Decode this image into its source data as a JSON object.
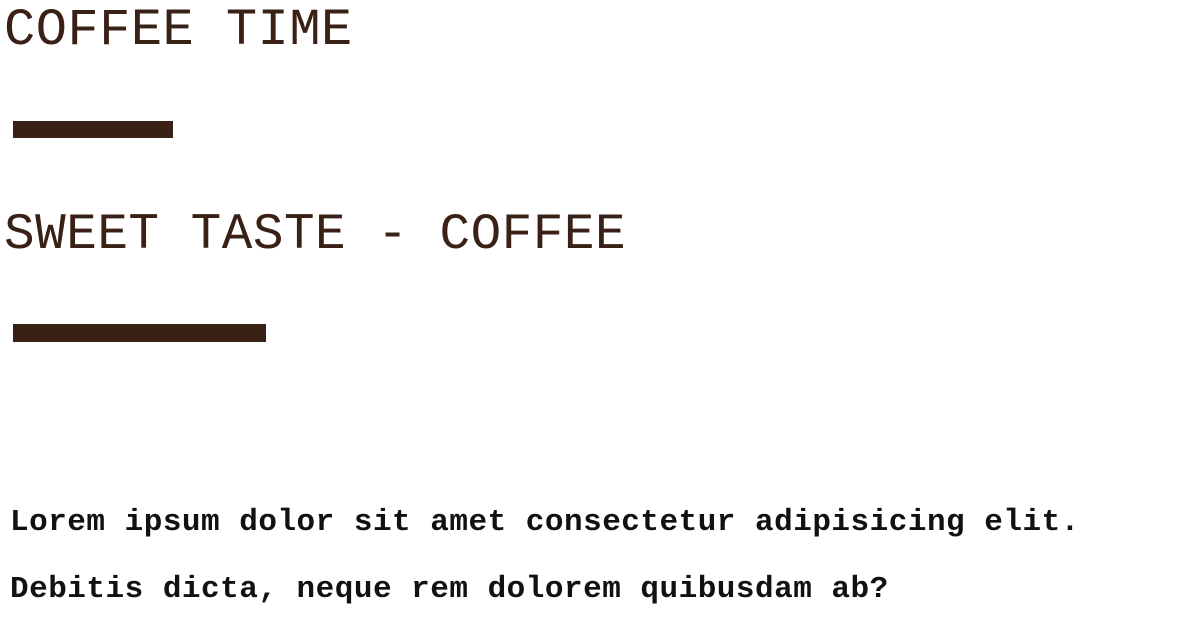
{
  "hero": {
    "title": "COFFEE TIME",
    "subtitle": "SWEET TASTE - COFFEE",
    "description": "Lorem ipsum dolor sit amet consectetur adipisicing elit. Debitis dicta, neque rem dolorem quibusdam ab?"
  },
  "colors": {
    "accent": "#3a2115",
    "body_text": "#111111",
    "background": "#ffffff"
  }
}
